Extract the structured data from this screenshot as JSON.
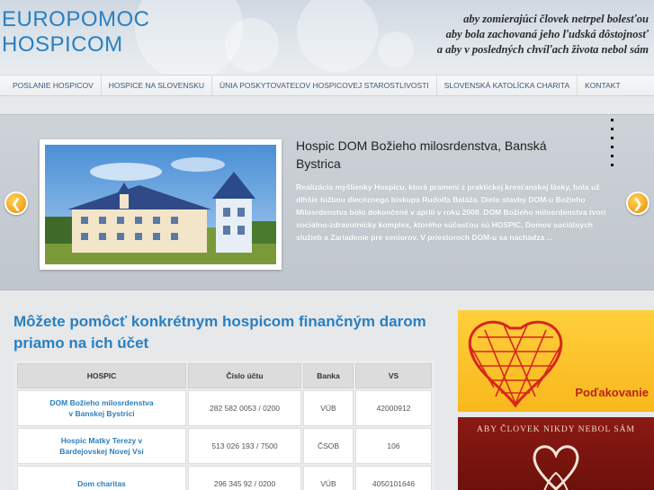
{
  "header": {
    "logo_line1": "EUROPOMOC",
    "logo_line2": "HOSPICOM",
    "tagline_line1": "aby zomierajúci človek netrpel bolesťou",
    "tagline_line2": "aby bola zachovaná jeho ľudská dôstojnosť",
    "tagline_line3": "a aby v posledných chvíľach života nebol sám"
  },
  "nav": {
    "items": [
      {
        "label": "POSLANIE HOSPICOV"
      },
      {
        "label": "HOSPICE NA SLOVENSKU"
      },
      {
        "label": "ÚNIA POSKYTOVATEĽOV HOSPICOVEJ STAROSTLIVOSTI"
      },
      {
        "label": "SLOVENSKÁ KATOLÍCKA CHARITA"
      },
      {
        "label": "KONTAKT"
      }
    ]
  },
  "slider": {
    "title": "Hospic DOM Božieho milosrdenstva, Banská Bystrica",
    "text": "Realizácia myšlienky Hospicu, ktorá pramení z praktickej kresťanskej lásky, bola už dlhšie túžbou diecéznego biskupa Rudolfa Baláža. Dielo stavby DOM-u Božieho Milosrdenstva bolo dokončené v apríli v roku 2008. DOM Božieho milosrdenstva tvorí sociálno-zdravotnícky komplex, ktorého súčasťou sú HOSPIC, Domov sociálnych služieb a Zariadenie pre seniorov. V priestoroch DOM-u sa nachádza ...",
    "prev_icon": "chevron-left-icon",
    "next_icon": "chevron-right-icon",
    "accent": "#f0a21a"
  },
  "main": {
    "heading": "Môžete pomôcť konkrétnym hospicom finančným darom priamo na ich účet",
    "table": {
      "headers": [
        "HOSPIC",
        "Číslo účtu",
        "Banka",
        "VS"
      ],
      "rows": [
        {
          "name_line1": "DOM Božieho milosrdenstva",
          "name_line2": "v Banskej Bystrici",
          "account": "282 582 0053 / 0200",
          "bank": "VÚB",
          "vs": "42000912"
        },
        {
          "name_line1": "Hospic Matky Terezy v",
          "name_line2": "Bardejovskej Novej Vsi",
          "account": "513 026 193 / 7500",
          "bank": "ČSOB",
          "vs": "106"
        },
        {
          "name_line1": "Dom charitas",
          "name_line2": "",
          "account": "296 345 92 / 0200",
          "bank": "VÚB",
          "vs": "4050101646"
        }
      ]
    }
  },
  "sidebar": {
    "banner1_label": "Poďakovanie",
    "banner2_label": "ABY ČLOVEK NIKDY NEBOL SÁM"
  },
  "colors": {
    "brand_blue": "#2a7fc0",
    "banner_yellow": "#f9b81d",
    "banner_red": "#7a1410"
  }
}
